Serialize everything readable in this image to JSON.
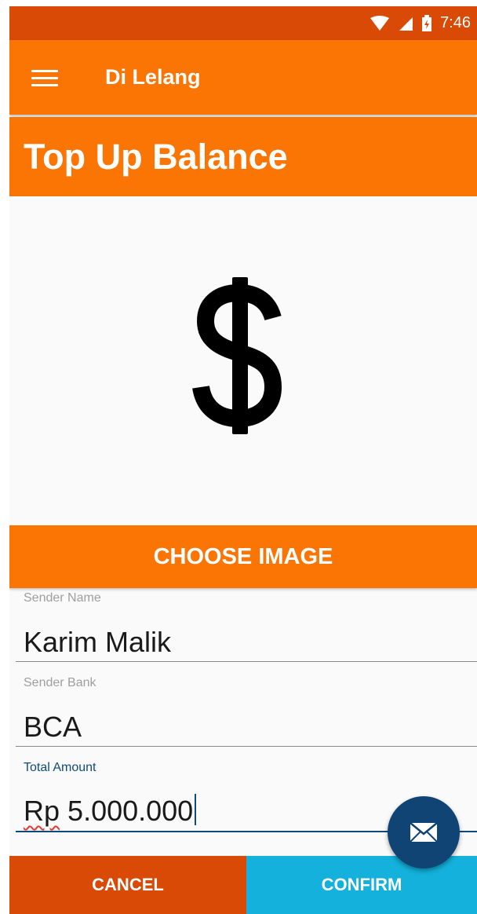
{
  "status_bar": {
    "time": "7:46"
  },
  "app_bar": {
    "title": "Di Lelang",
    "menu_icon": "hamburger-menu-icon"
  },
  "page": {
    "title": "Top Up Balance",
    "image_placeholder_icon": "dollar-icon"
  },
  "choose_image": {
    "label": "CHOOSE IMAGE"
  },
  "form": {
    "sender_name": {
      "label": "Sender Name",
      "value": "Karim Malik"
    },
    "sender_bank": {
      "label": "Sender Bank",
      "value": "BCA"
    },
    "total_amount": {
      "label": "Total Amount",
      "prefix": "Rp",
      "value": "5.000.000"
    }
  },
  "actions": {
    "cancel_label": "CANCEL",
    "confirm_label": "CONFIRM",
    "fab_icon": "mail-icon"
  },
  "colors": {
    "status_bar": "#d84a05",
    "primary": "#fb7505",
    "cancel": "#d84a05",
    "confirm": "#13b1dc",
    "fab": "#0f4474",
    "accent": "#0e4a7c"
  }
}
